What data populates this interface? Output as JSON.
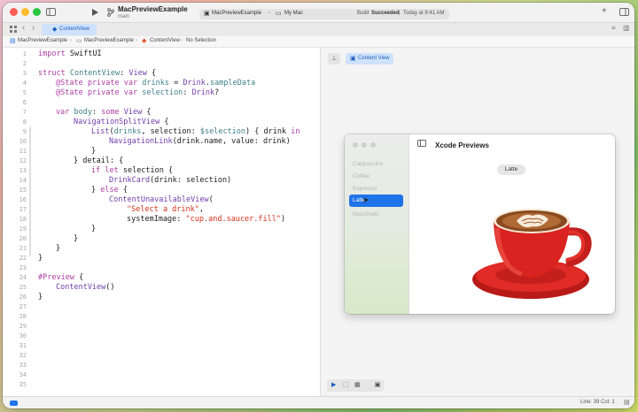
{
  "titlebar": {
    "project_name": "MacPreviewExample",
    "branch": "main",
    "scheme_target": "MacPreviewExample",
    "destination": "My Mac",
    "build_status_prefix": "Build",
    "build_status_result": "Succeeded",
    "build_status_time": "Today at 9:41 AM",
    "add_icon": "+"
  },
  "tab": {
    "label": "ContentView"
  },
  "jumpbar": {
    "crumbs": [
      "MacPreviewExample",
      "MacPreviewExample",
      "ContentView",
      "No Selection"
    ]
  },
  "editor": {
    "line_numbers": [
      "1",
      "2",
      "3",
      "4",
      "5",
      "6",
      "7",
      "8",
      "9",
      "10",
      "11",
      "12",
      "13",
      "14",
      "15",
      "16",
      "17",
      "18",
      "19",
      "20",
      "21",
      "22",
      "23",
      "24",
      "25",
      "26",
      "27",
      "28",
      "29",
      "30",
      "31",
      "32",
      "33",
      "34",
      "35"
    ],
    "code": {
      "l1_kw": "import",
      "l1_rest": " SwiftUI",
      "l3_kw": "struct",
      "l3_name": " ContentView",
      "l3_colon": ": ",
      "l3_ty": "View",
      "l3_brace": " {",
      "l4_kw": "@State private var",
      "l4_var": " drinks",
      "l4_eq": " = ",
      "l4_ty": "Drink",
      "l4_dot": ".",
      "l4_fn": "sampleData",
      "l5_kw": "@State private var",
      "l5_var": " selection",
      "l5_colon": ": ",
      "l5_ty": "Drink",
      "l5_q": "?",
      "l7_kw": "var",
      "l7_var": " body",
      "l7_colon": ": ",
      "l7_kw2": "some",
      "l7_ty": " View",
      "l7_brace": " {",
      "l8_ty": "NavigationSplitView",
      "l8_brace": " {",
      "l9_ty": "List",
      "l9_a": "(",
      "l9_fn": "drinks",
      "l9_b": ", selection: ",
      "l9_fn2": "$selection",
      "l9_c": ") { drink ",
      "l9_kw": "in",
      "l10_ty": "NavigationLink",
      "l10_rest": "(drink.name, value: drink)",
      "l11": "}",
      "l12": "} detail: {",
      "l13_kw": "if let",
      "l13_rest": " selection {",
      "l14_ty": "DrinkCard",
      "l14_rest": "(drink: selection)",
      "l15_a": "} ",
      "l15_kw": "else",
      "l15_b": " {",
      "l16_ty": "ContentUnavailableView",
      "l16_rest": "(",
      "l17_str": "\"Select a drink\"",
      "l17_rest": ",",
      "l18_a": "systemImage: ",
      "l18_str": "\"cup.and.saucer.fill\"",
      "l18_b": ")",
      "l19": "}",
      "l20": "}",
      "l21": "}",
      "l22": "}",
      "l24_kw": "#Preview",
      "l24_rest": " {",
      "l25_ty": "ContentView",
      "l25_rest": "()",
      "l26": "}"
    }
  },
  "preview": {
    "chip_label": "Content View",
    "window_title": "Xcode Previews",
    "sidebar_items": [
      "Cappuccino",
      "Coffee",
      "Espresso",
      "Latte",
      "Macchiato"
    ],
    "selected_item": "Latte",
    "detail_chip": "Latte"
  },
  "statusbar": {
    "position": "Line: 39  Col: 1"
  },
  "colors": {
    "accent": "#1f73e8",
    "keyword": "#ad3da4",
    "type": "#703daa",
    "string": "#d12f1b",
    "cup_red": "#d92320"
  }
}
